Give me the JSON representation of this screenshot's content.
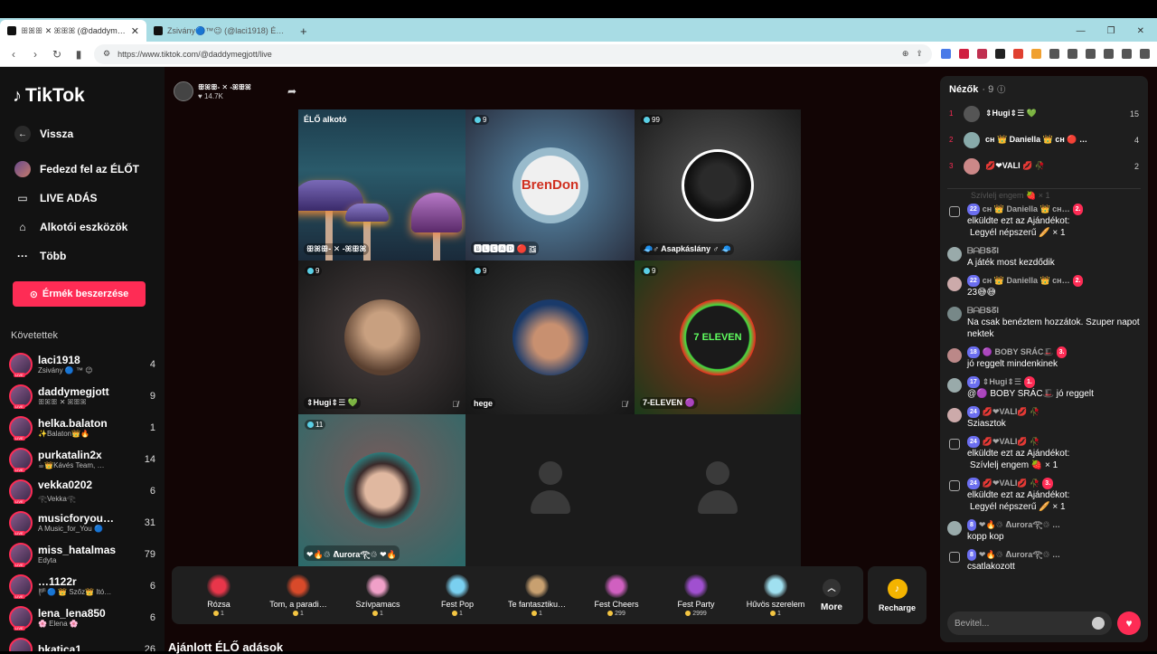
{
  "browser": {
    "tabs": [
      {
        "title": "ꕥꕤꕥ ✕ ꕤꕥꕤ (@daddym…",
        "active": true
      },
      {
        "title": "Zsivány🔵™😉 (@laci1918) ÉLŐ a…",
        "active": false
      }
    ],
    "new_tab": "+",
    "url": "https://www.tiktok.com/@daddymegjott/live"
  },
  "sidebar": {
    "logo": "TikTok",
    "nav": [
      {
        "label": "Vissza",
        "icon": "back-arrow-icon"
      },
      {
        "label": "Fedezd fel az ÉLŐT",
        "icon": "explore-avatar-icon"
      },
      {
        "label": "LIVE ADÁS",
        "icon": "video-camera-icon"
      },
      {
        "label": "Alkotói eszközök",
        "icon": "home-icon"
      },
      {
        "label": "Több",
        "icon": "more-dots-icon"
      }
    ],
    "coins_button": "Érmék beszerzése",
    "following_title": "Követettek",
    "following": [
      {
        "name": "laci1918",
        "sub": "Zsivány 🔵 ™ 😉",
        "count": "4"
      },
      {
        "name": "daddymegjott",
        "sub": "ꕥꕤꕥ ✕ ꕤꕥꕤ",
        "count": "9"
      },
      {
        "name": "helka.balaton",
        "sub": "✨Balaton👑🔥",
        "count": "1"
      },
      {
        "name": "purkatalin2x",
        "sub": "☕👑Kávés Team, …",
        "count": "14"
      },
      {
        "name": "vekka0202",
        "sub": "𓂀Vekka𓂀",
        "count": "6"
      },
      {
        "name": "musicforyou…",
        "sub": "A Music_for_You 🔵",
        "count": "31"
      },
      {
        "name": "miss_hatalmas",
        "sub": "Edyta",
        "count": "79"
      },
      {
        "name": "…1122r",
        "sub": "🏴🔵 👑 Szőz👑 Itó…",
        "count": "6"
      },
      {
        "name": "lena_lena850",
        "sub": "🌸 Elena 🌸",
        "count": "6"
      },
      {
        "name": "bkatica1",
        "sub": "",
        "count": "26"
      }
    ]
  },
  "host": {
    "name": "ꕥꕤꕥ- ✕ -ꕤꕥꕤ",
    "likes": "♥ 14.7K"
  },
  "grid": {
    "cells": [
      {
        "badge": "ÉLŐ alkotó",
        "name": "ꕥꕤꕥ- ✕ -ꕤꕥꕤ",
        "type": "host"
      },
      {
        "badge": "9",
        "name": "🅱🅻🅴🅰🅳 🔴 🇬",
        "type": "guest",
        "avatar_text": "BrenDon"
      },
      {
        "badge": "99",
        "name": "🧢♂ Asapkáslány ♂ 🧢",
        "type": "guest"
      },
      {
        "badge": "9",
        "name": "⇕Hugi⇕☰ 💚",
        "type": "guest",
        "muted": true
      },
      {
        "badge": "9",
        "name": "hege",
        "type": "guest",
        "muted": true
      },
      {
        "badge": "9",
        "name": "7-ELEVEN 🟣",
        "type": "guest",
        "avatar_text": "7 ELEVEN"
      },
      {
        "badge": "11",
        "name": "❤🔥♲ ᕕurora𓂀♲ ❤🔥",
        "type": "guest"
      },
      {
        "badge": "",
        "name": "",
        "type": "empty"
      },
      {
        "badge": "",
        "name": "",
        "type": "empty"
      }
    ]
  },
  "gifts": [
    {
      "name": "Rózsa",
      "price": "1",
      "color": "#e8364a"
    },
    {
      "name": "Tom, a paradi…",
      "price": "1",
      "color": "#d84a2a"
    },
    {
      "name": "Szívpamacs",
      "price": "1",
      "color": "#f0a0c8"
    },
    {
      "name": "Fest Pop",
      "price": "1",
      "color": "#7ad0f0"
    },
    {
      "name": "Te fantasztiku…",
      "price": "1",
      "color": "#c8a070"
    },
    {
      "name": "Fest Cheers",
      "price": "299",
      "color": "#d060c0"
    },
    {
      "name": "Fest Party",
      "price": "2999",
      "color": "#a050d0"
    },
    {
      "name": "Hűvös szerelem",
      "price": "1",
      "color": "#a0e0f0"
    }
  ],
  "more_label": "More",
  "recharge_label": "Recharge",
  "recommended": "Ajánlott ÉLŐ adások",
  "viewers": {
    "title": "Nézők",
    "count": "· 9",
    "top": [
      {
        "rank": "1",
        "name": "⇕Hugi⇕☰ 💚",
        "score": "15"
      },
      {
        "rank": "2",
        "name": "ᴄʜ 👑 Daniella 👑 ᴄʜ 🔴 …",
        "score": "4"
      },
      {
        "rank": "3",
        "name": "💋❤VALI 💋 🥀",
        "score": "2"
      }
    ]
  },
  "chat": {
    "fade_text": "Szívlelj engem 🍓 × 1",
    "messages": [
      {
        "icon": "gift",
        "level": "22",
        "user": "ᴄʜ 👑 Daniella 👑 ᴄʜ…",
        "fan": "2.",
        "text": "elküldte ezt az Ajándékot:",
        "text2": "Legyél népszerű 🥖 × 1"
      },
      {
        "icon": "avatar",
        "level": "",
        "user": "ᗷᗩᗷՏᘔI",
        "fan": "",
        "text": "A játék most kezdődik",
        "text2": ""
      },
      {
        "icon": "avatar",
        "level": "22",
        "user": "ᴄʜ 👑 Daniella 👑 ᴄʜ…",
        "fan": "2.",
        "text": "23😅😅",
        "text2": ""
      },
      {
        "icon": "avatar",
        "level": "",
        "user": "ᗷᗩᗷՏᘔI",
        "fan": "",
        "text": "Na csak benéztem hozzátok. Szuper napot nektek",
        "text2": ""
      },
      {
        "icon": "avatar",
        "level": "18",
        "user": "🟣 BOBY SRÁC🎩",
        "fan": "3.",
        "text": "jó reggelt mindenkinek",
        "text2": ""
      },
      {
        "icon": "avatar",
        "level": "17",
        "user": "⇕Hugi⇕☰",
        "fan": "1.",
        "text": "@🟣 BOBY SRÁC🎩 jó reggelt",
        "text2": ""
      },
      {
        "icon": "avatar",
        "level": "24",
        "user": "💋❤VALI💋 🥀",
        "fan": "",
        "text": "Sziasztok",
        "text2": ""
      },
      {
        "icon": "gift",
        "level": "24",
        "user": "💋❤VALI💋 🥀",
        "fan": "",
        "text": "elküldte ezt az Ajándékot:",
        "text2": "Szívlelj engem 🍓 × 1"
      },
      {
        "icon": "gift",
        "level": "24",
        "user": "💋❤VALI💋 🥀",
        "fan": "3.",
        "text": "elküldte ezt az Ajándékot:",
        "text2": "Legyél népszerű 🥖 × 1"
      },
      {
        "icon": "avatar",
        "level": "8",
        "user": "❤🔥♲ ᕕurora𓂀♲ …",
        "fan": "",
        "text": "kopp kop",
        "text2": ""
      },
      {
        "icon": "join",
        "level": "8",
        "user": "❤🔥♲ ᕕurora𓂀♲ …",
        "fan": "",
        "text": "csatlakozott",
        "text2": ""
      }
    ],
    "input_placeholder": "Bevitel..."
  }
}
